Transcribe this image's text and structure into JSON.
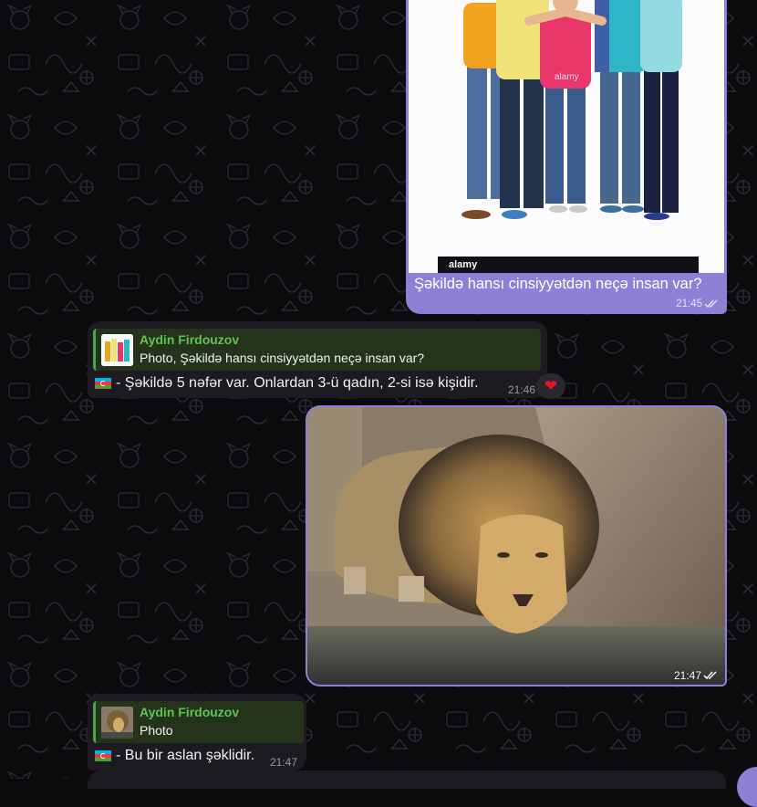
{
  "messages": {
    "out_photo_1": {
      "caption": "Şəkildə hansı cinsiyyətdən neçə insan var?",
      "time": "21:45",
      "watermark": "alamy"
    },
    "reply_1": {
      "sender": "Aydin Firdouzov",
      "quoted_text": "Photo, Şəkildə hansı cinsiyyətdən neçə insan var?",
      "text": "- Şəkildə 5 nəfər var. Onlardan 3-ü qadın, 2-si isə kişidir.",
      "time": "21:46",
      "reaction": "❤"
    },
    "out_photo_2": {
      "time": "21:47"
    },
    "reply_2": {
      "sender": "Aydin Firdouzov",
      "quoted_text": "Photo",
      "text": "- Bu bir aslan şəklidir.",
      "time": "21:47"
    }
  },
  "colors": {
    "background": "#0b0a0d",
    "outgoing_bubble": "#8f7fd6",
    "incoming_bubble": "#1d1b20",
    "sender_name": "#5fc450",
    "reply_accent": "#4aa84a"
  },
  "icons": [
    "double-check-icon",
    "heart-icon",
    "azerbaijan-flag-icon"
  ]
}
